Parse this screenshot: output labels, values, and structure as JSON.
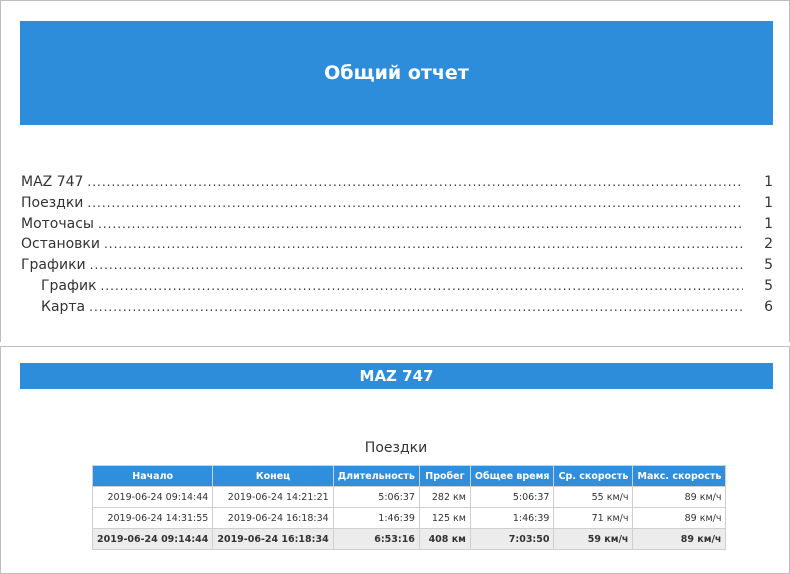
{
  "colors": {
    "accent": "#2d8ddb",
    "header_bg": "#2f8fdc"
  },
  "report": {
    "title": "Общий отчет"
  },
  "toc": [
    {
      "label": "MAZ 747",
      "page": "1",
      "level": 0
    },
    {
      "label": "Поездки",
      "page": "1",
      "level": 0
    },
    {
      "label": "Моточасы",
      "page": "1",
      "level": 0
    },
    {
      "label": "Остановки",
      "page": "2",
      "level": 0
    },
    {
      "label": "Графики",
      "page": "5",
      "level": 0
    },
    {
      "label": "График",
      "page": "5",
      "level": 1
    },
    {
      "label": "Карта",
      "page": "6",
      "level": 1
    }
  ],
  "section": {
    "title": "MAZ 747"
  },
  "trips_table": {
    "title": "Поездки",
    "columns": [
      "Начало",
      "Конец",
      "Длительность",
      "Пробег",
      "Общее время",
      "Ср. скорость",
      "Макс. скорость"
    ],
    "rows": [
      [
        "2019-06-24 09:14:44",
        "2019-06-24 14:21:21",
        "5:06:37",
        "282 км",
        "5:06:37",
        "55 км/ч",
        "89 км/ч"
      ],
      [
        "2019-06-24 14:31:55",
        "2019-06-24 16:18:34",
        "1:46:39",
        "125 км",
        "1:46:39",
        "71 км/ч",
        "89 км/ч"
      ]
    ],
    "total": [
      "2019-06-24 09:14:44",
      "2019-06-24 16:18:34",
      "6:53:16",
      "408 км",
      "7:03:50",
      "59 км/ч",
      "89 км/ч"
    ]
  }
}
